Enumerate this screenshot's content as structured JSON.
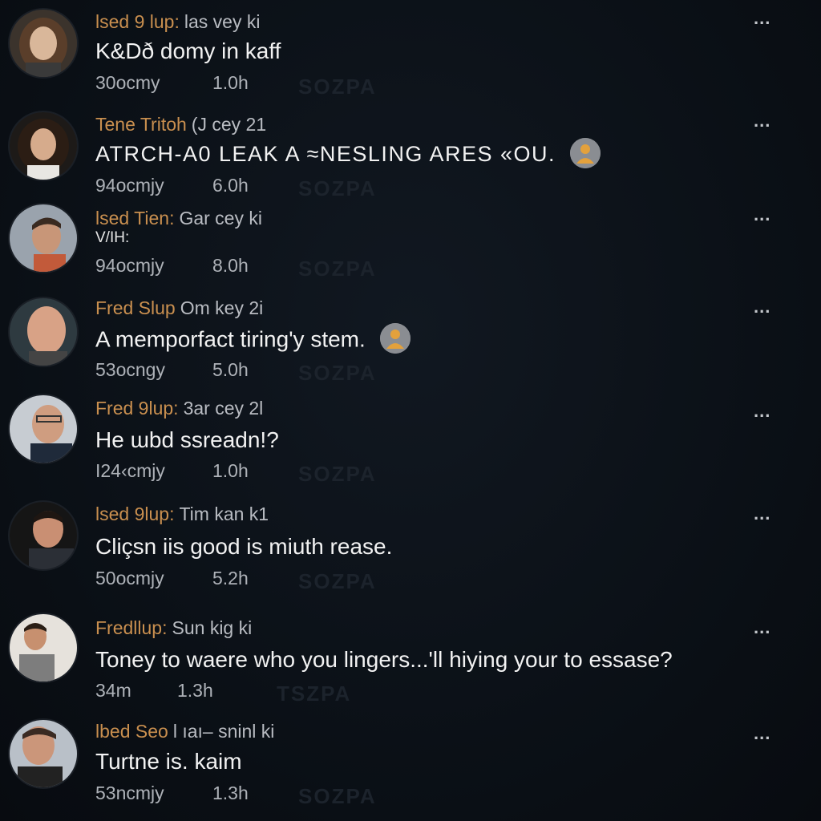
{
  "comments": [
    {
      "author": "lsed 9 lup",
      "meta": "las vey ki",
      "body": "K&Dð domy in kaff",
      "likes": "30ocmy",
      "time": "1.0h",
      "watermark": "SOZPA",
      "more": "..."
    },
    {
      "author": "Tene Tritoh",
      "meta": "(J cey 21",
      "body": "ATRCH-A0 LEAK A ≈NESLING ARES «ΟU.",
      "likes": "94ocmjy",
      "time": "6.0h",
      "watermark": "SOZPA",
      "more": "...",
      "reaction_icon": "person-icon"
    },
    {
      "author": "lsed Tien",
      "meta": "Gar cey ki",
      "body": "V/IH:",
      "likes": "94ocmjy",
      "time": "8.0h",
      "watermark": "SOZPA",
      "more": "..."
    },
    {
      "author": "Fred Slup",
      "meta": "Om key 2i",
      "body": "A memporfact tiring'y stem.",
      "likes": "53ocngy",
      "time": "5.0h",
      "watermark": "SOZPA",
      "more": "...",
      "reaction_icon": "person-icon"
    },
    {
      "author": "Fred 9lup",
      "meta": "3ar cey 2l",
      "body": "He ɯbd ssreadn!?",
      "likes": "I24‹cmjy",
      "time": "1.0h",
      "watermark": "SOZPA",
      "more": "..."
    },
    {
      "author": "lsed 9lup",
      "meta": "Tim kan k1",
      "body": "Cliçsn iis good is miuth rease.",
      "likes": "50ocmjy",
      "time": "5.2h",
      "watermark": "SOZPA",
      "more": "..."
    },
    {
      "author": "Fredllup",
      "meta": "Sun kig ki",
      "body": "Toney to waere who you lingers...'ll hiying your to essase?",
      "likes": "34m",
      "time": "1.3h",
      "watermark": "TSZPA",
      "more": "..."
    },
    {
      "author": "lbed Seo",
      "meta": "l ıaı– sninl ki",
      "body": "Turtne is. kaim",
      "likes": "53ncmjy",
      "time": "1.3h",
      "watermark": "SOZPA",
      "more": "..."
    }
  ],
  "colors": {
    "background": "#0b1017",
    "author": "#c98f4f",
    "body": "#f2f2f2",
    "meta": "#b9bcc2",
    "reaction_bg": "#8a8d92",
    "reaction_fg": "#e3a13c"
  }
}
